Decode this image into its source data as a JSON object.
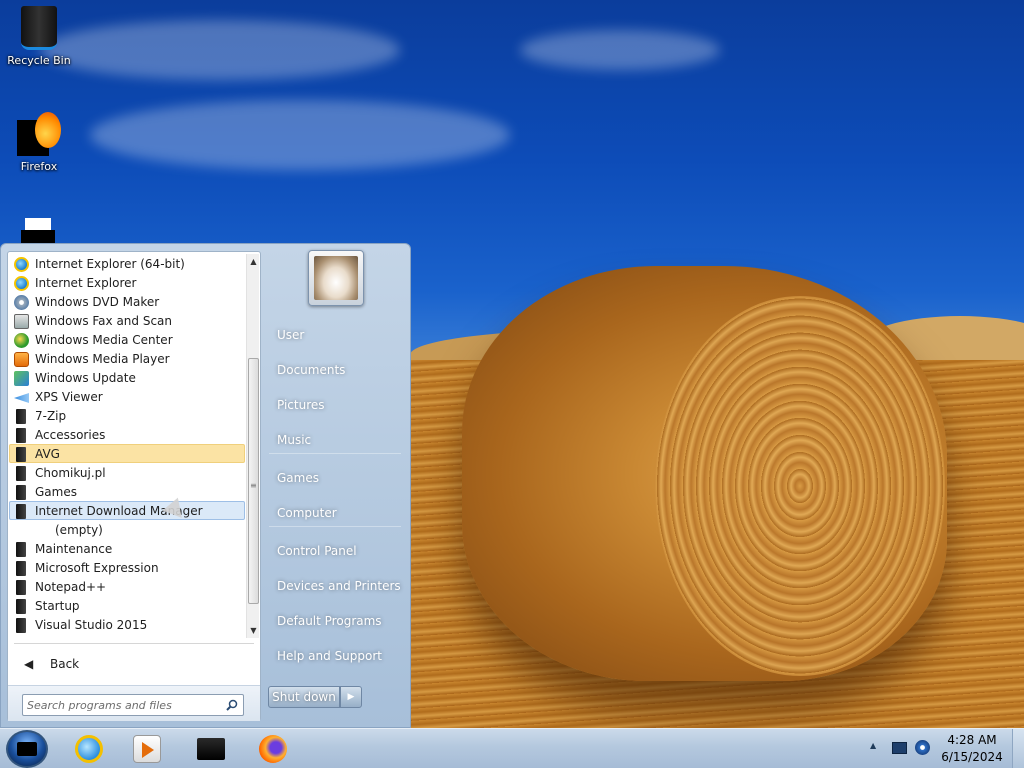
{
  "desktop": {
    "icons": [
      {
        "label": "Recycle Bin",
        "icon": "recycle-bin-icon"
      },
      {
        "label": "Firefox",
        "icon": "firefox-icon"
      },
      {
        "label": "",
        "icon": "document-icon"
      }
    ]
  },
  "start_menu": {
    "programs": [
      {
        "label": "Internet Explorer (64-bit)",
        "icon": "internet-explorer-icon"
      },
      {
        "label": "Internet Explorer",
        "icon": "internet-explorer-icon"
      },
      {
        "label": "Windows DVD Maker",
        "icon": "dvd-maker-icon"
      },
      {
        "label": "Windows Fax and Scan",
        "icon": "fax-scan-icon"
      },
      {
        "label": "Windows Media Center",
        "icon": "media-center-icon"
      },
      {
        "label": "Windows Media Player",
        "icon": "media-player-icon"
      },
      {
        "label": "Windows Update",
        "icon": "windows-update-icon"
      },
      {
        "label": "XPS Viewer",
        "icon": "xps-viewer-icon"
      },
      {
        "label": "7-Zip",
        "icon": "folder-icon"
      },
      {
        "label": "Accessories",
        "icon": "folder-icon"
      },
      {
        "label": "AVG",
        "icon": "folder-icon",
        "state": "active"
      },
      {
        "label": "Chomikuj.pl",
        "icon": "folder-icon"
      },
      {
        "label": "Games",
        "icon": "folder-icon"
      },
      {
        "label": "Internet Download Manager",
        "icon": "folder-icon",
        "state": "hover"
      },
      {
        "label": "(empty)",
        "icon": "",
        "sub": true
      },
      {
        "label": "Maintenance",
        "icon": "folder-icon"
      },
      {
        "label": "Microsoft Expression",
        "icon": "folder-icon"
      },
      {
        "label": "Notepad++",
        "icon": "folder-icon"
      },
      {
        "label": "Startup",
        "icon": "folder-icon"
      },
      {
        "label": "Visual Studio 2015",
        "icon": "folder-icon"
      }
    ],
    "back_label": "Back",
    "search_placeholder": "Search programs and files",
    "right_items": [
      {
        "label": "User",
        "name": "right-item-user"
      },
      {
        "label": "Documents",
        "name": "right-item-documents"
      },
      {
        "label": "Pictures",
        "name": "right-item-pictures"
      },
      {
        "label": "Music",
        "name": "right-item-music"
      },
      {
        "label": "Games",
        "name": "right-item-games"
      },
      {
        "label": "Computer",
        "name": "right-item-computer"
      },
      {
        "label": "Control Panel",
        "name": "right-item-control-panel"
      },
      {
        "label": "Devices and Printers",
        "name": "right-item-devices-printers"
      },
      {
        "label": "Default Programs",
        "name": "right-item-default-programs"
      },
      {
        "label": "Help and Support",
        "name": "right-item-help-support"
      }
    ],
    "shutdown_label": "Shut down"
  },
  "taskbar": {
    "pinned": [
      {
        "name": "taskbar-internet-explorer",
        "icon": "internet-explorer-icon"
      },
      {
        "name": "taskbar-media-player",
        "icon": "media-player-icon"
      },
      {
        "name": "taskbar-explorer",
        "icon": "folder-icon"
      },
      {
        "name": "taskbar-firefox",
        "icon": "firefox-icon"
      }
    ],
    "clock": {
      "time": "4:28 AM",
      "date": "6/15/2024"
    }
  },
  "colors": {
    "menu_highlight_active": "#fbe3a4",
    "menu_highlight_hover": "#dbe9f8",
    "taskbar": "#b4c8de"
  }
}
